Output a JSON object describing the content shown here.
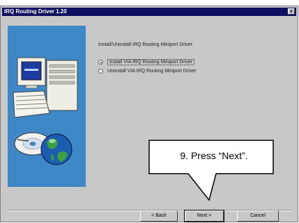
{
  "window": {
    "title": "IRQ Routing Driver 1.20",
    "close_glyph": "x"
  },
  "content": {
    "description": "Install/Uninstall IRQ Routing Miniport Driver.",
    "options": [
      {
        "label": "Install VIA IRQ Routing Miniport Driver",
        "selected": true
      },
      {
        "label": "Uninstall VIA IRQ Routing Miniport Driver",
        "selected": false
      }
    ]
  },
  "buttons": {
    "back": "< Back",
    "next": "Next >",
    "cancel": "Cancel"
  },
  "callout": {
    "text": "9. Press “Next”."
  },
  "colors": {
    "side_panel": "#3f88c8",
    "title_bar": "#101060",
    "dialog_face": "#c8c8c8"
  },
  "icons": [
    "computer-icon",
    "cd-disc-icon",
    "globe-icon"
  ]
}
